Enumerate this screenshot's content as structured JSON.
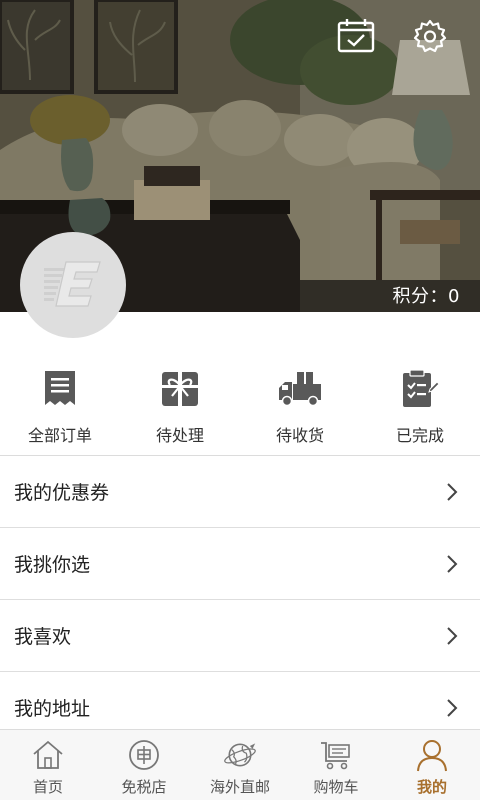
{
  "header": {
    "points_label": "积分：",
    "points_value": "0"
  },
  "icons": {
    "calendar": "calendar-check-icon",
    "settings": "gear-icon",
    "avatar": "brand-logo-e-icon"
  },
  "orders": [
    {
      "label": "全部订单",
      "icon": "receipt-icon"
    },
    {
      "label": "待处理",
      "icon": "gift-box-icon"
    },
    {
      "label": "待收货",
      "icon": "delivery-truck-icon"
    },
    {
      "label": "已完成",
      "icon": "clipboard-check-icon"
    }
  ],
  "menu": [
    {
      "label": "我的优惠券"
    },
    {
      "label": "我挑你选"
    },
    {
      "label": "我喜欢"
    },
    {
      "label": "我的地址"
    }
  ],
  "tabs": [
    {
      "label": "首页",
      "icon": "home-icon",
      "active": false
    },
    {
      "label": "免税店",
      "icon": "tax-free-coin-icon",
      "active": false
    },
    {
      "label": "海外直邮",
      "icon": "globe-plane-icon",
      "active": false
    },
    {
      "label": "购物车",
      "icon": "cart-icon",
      "active": false
    },
    {
      "label": "我的",
      "icon": "user-icon",
      "active": true
    }
  ],
  "colors": {
    "active_tab": "#a8702e",
    "icon_gray": "#595959",
    "divider": "#dcdcdc"
  }
}
